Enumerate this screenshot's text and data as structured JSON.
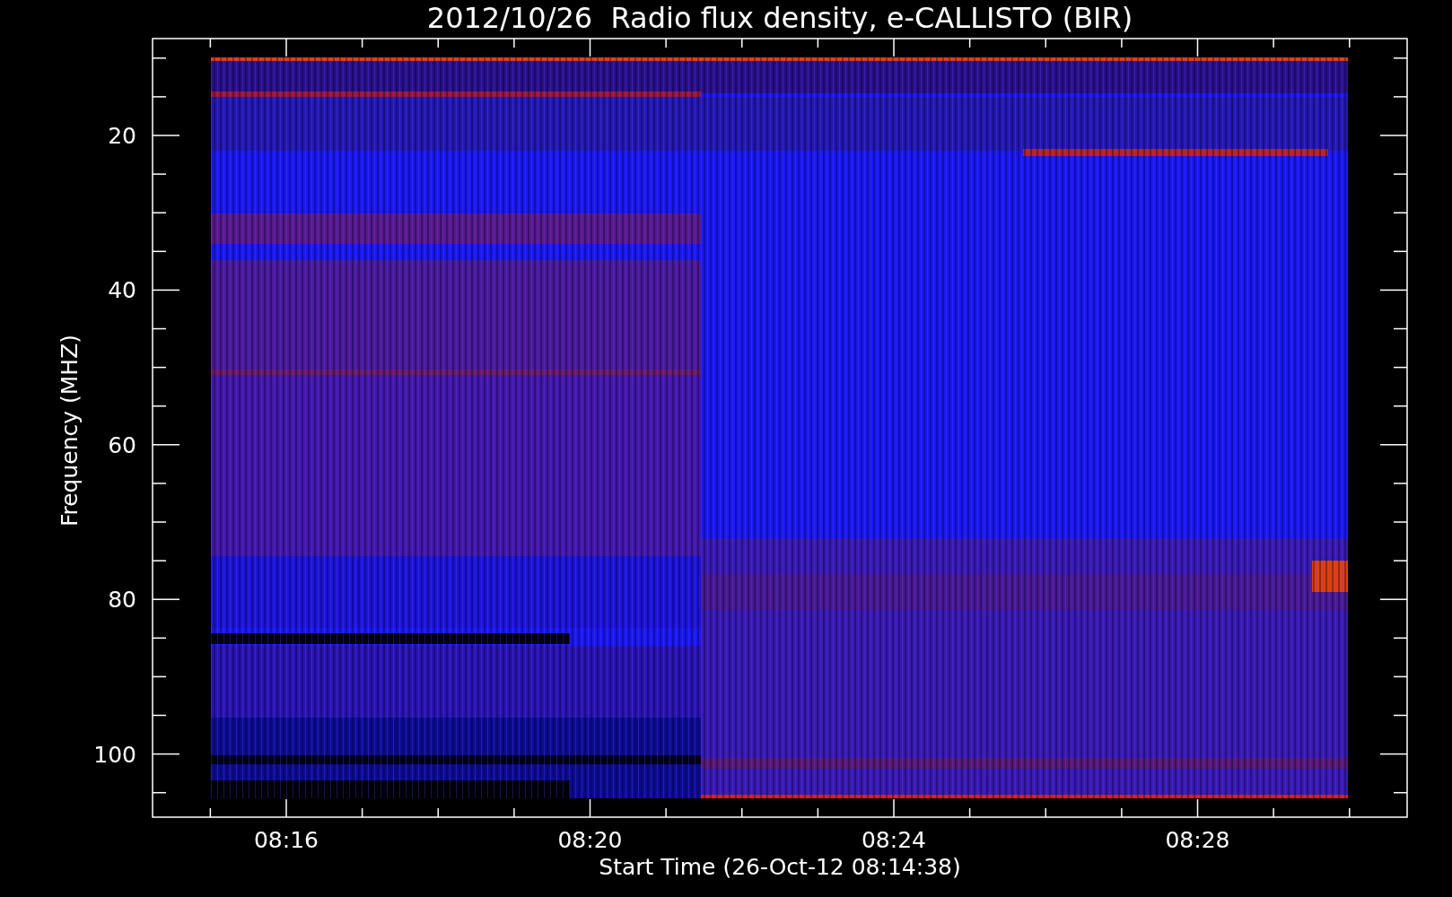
{
  "title": "2012/10/26  Radio flux density, e-CALLISTO (BIR)",
  "y_axis": {
    "label": "Frequency (MHZ)",
    "ticks": [
      "20",
      "40",
      "60",
      "80",
      "100"
    ]
  },
  "x_axis": {
    "label": "Start Time (26-Oct-12 08:14:38)",
    "ticks": [
      "08:16",
      "08:20",
      "08:24",
      "08:28"
    ]
  }
}
